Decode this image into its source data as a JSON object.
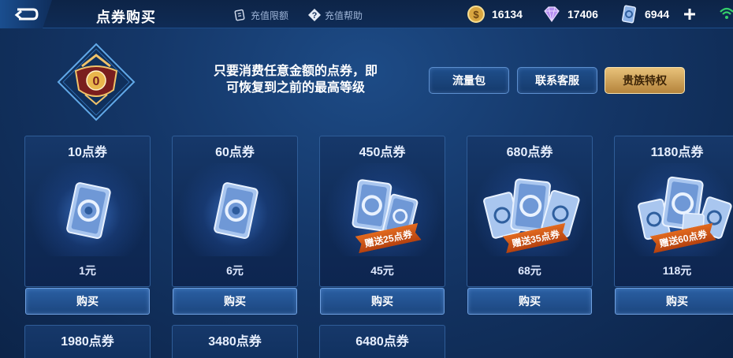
{
  "header": {
    "title": "点券购买",
    "links": {
      "limit": "充值限额",
      "help": "充值帮助"
    },
    "currencies": {
      "gold": "16134",
      "diamond": "17406",
      "voucher": "6944"
    }
  },
  "banner": {
    "line1": "只要消费任意金额的点券，即",
    "line2": "可恢复到之前的最高等级",
    "buttons": {
      "traffic": "流量包",
      "service": "联系客服",
      "noble": "贵族特权"
    }
  },
  "buy_label": "购买",
  "cards": [
    {
      "name": "10点券",
      "price": "1元",
      "bonus": ""
    },
    {
      "name": "60点券",
      "price": "6元",
      "bonus": ""
    },
    {
      "name": "450点券",
      "price": "45元",
      "bonus": "赠送25点券"
    },
    {
      "name": "680点券",
      "price": "68元",
      "bonus": "赠送35点券"
    },
    {
      "name": "1180点券",
      "price": "118元",
      "bonus": "赠送60点券"
    }
  ],
  "cards_row2": [
    {
      "name": "1980点券"
    },
    {
      "name": "3480点券"
    },
    {
      "name": "6480点券"
    }
  ],
  "colors": {
    "accent_gold": "#e8c27a",
    "ribbon": "#d45a18",
    "button_blue": "#2a5fa3"
  },
  "icons": [
    "back-arrow-icon",
    "limit-card-icon",
    "help-question-icon",
    "gold-coin-icon",
    "diamond-icon",
    "voucher-icon",
    "plus-icon",
    "wifi-icon",
    "rank-emblem-icon",
    "voucher-ticket-icon"
  ]
}
